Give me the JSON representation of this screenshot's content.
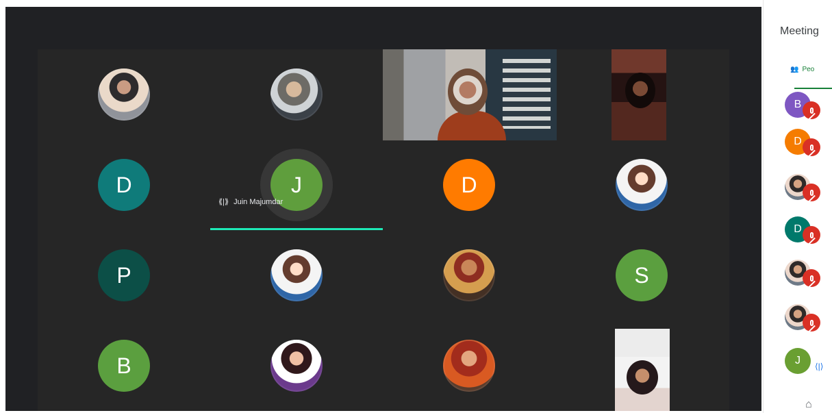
{
  "meeting": {
    "active_speaker": {
      "name": "Juin Majumdar",
      "initial": "J"
    },
    "tiles": [
      {
        "type": "photo",
        "variant": "alt1"
      },
      {
        "type": "photo",
        "variant": ""
      },
      {
        "type": "video"
      },
      {
        "type": "portrait"
      },
      {
        "type": "initial",
        "initial": "D",
        "color": "teal"
      },
      {
        "type": "initial",
        "initial": "J",
        "color": "green",
        "speaking": true
      },
      {
        "type": "initial",
        "initial": "D",
        "color": "orange"
      },
      {
        "type": "photo",
        "variant": "alt2"
      },
      {
        "type": "initial",
        "initial": "P",
        "color": "dark-green"
      },
      {
        "type": "photo",
        "variant": "alt2"
      },
      {
        "type": "photo",
        "variant": "alt3"
      },
      {
        "type": "initial",
        "initial": "S",
        "color": "olive"
      },
      {
        "type": "initial",
        "initial": "B",
        "color": "olive"
      },
      {
        "type": "photo",
        "variant": "alt4"
      },
      {
        "type": "photo",
        "variant": "alt5"
      },
      {
        "type": "portrait",
        "variant": "bottom"
      }
    ]
  },
  "sidebar": {
    "title": "Meeting",
    "tab_label": "Peo",
    "people": [
      {
        "initial": "B",
        "color": "#7e57c2",
        "muted": true
      },
      {
        "initial": "D",
        "color": "#f57c00",
        "muted": true
      },
      {
        "initial": "",
        "color": "photo",
        "muted": true
      },
      {
        "initial": "D",
        "color": "#00796b",
        "muted": true
      },
      {
        "initial": "",
        "color": "photo",
        "muted": true
      },
      {
        "initial": "",
        "color": "photo",
        "muted": true
      },
      {
        "initial": "J",
        "color": "#6a9f32",
        "muted": false
      }
    ],
    "active_audio_icon": "audio-level-icon",
    "footer_icon": "pin-icon"
  },
  "colors": {
    "stage": "#202124",
    "grid": "#262626",
    "speaker_accent": "#1de9b6",
    "mute_red": "#d93025",
    "sidebar_green": "#188038"
  }
}
